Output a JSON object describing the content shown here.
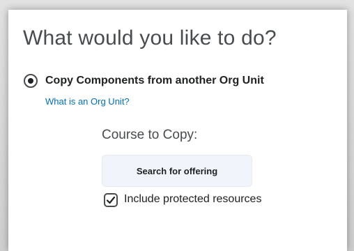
{
  "dialog": {
    "title": "What would you like to do?",
    "option": {
      "label": "Copy Components from another Org Unit",
      "selected": true,
      "help_link": "What is an Org Unit?"
    },
    "course_to_copy": {
      "label": "Course to Copy:",
      "search_button": "Search for offering"
    },
    "include_protected": {
      "label": "Include protected resources",
      "checked": true
    }
  },
  "icons": {
    "radio": "radio-selected-icon",
    "checkbox": "checkmark-icon"
  },
  "colors": {
    "link": "#006fbf",
    "text": "#202122",
    "heading": "#494c4e",
    "button_bg": "#f1f5fb"
  }
}
